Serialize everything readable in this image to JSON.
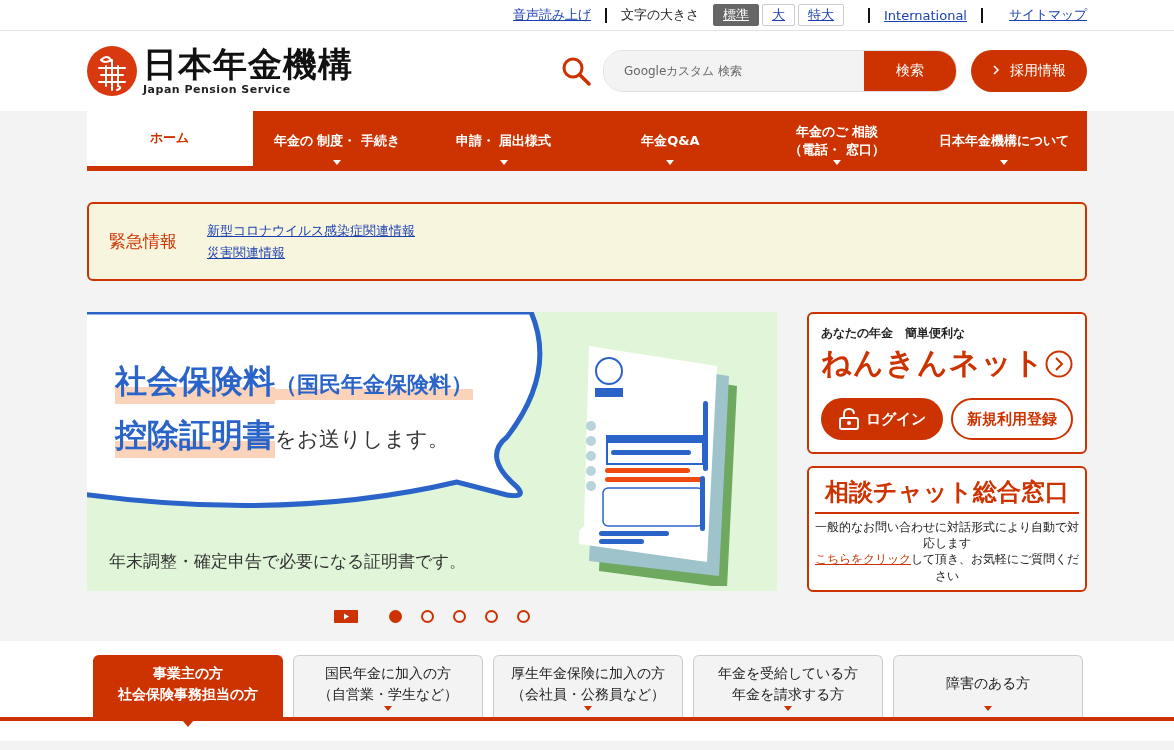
{
  "utility_bar": {
    "read_aloud": "音声読み上げ",
    "font_size_label": "文字の大きさ",
    "font_sizes": [
      {
        "label": "標準",
        "selected": true
      },
      {
        "label": "大",
        "selected": false
      },
      {
        "label": "特大",
        "selected": false
      }
    ],
    "international": "International",
    "sitemap": "サイトマップ"
  },
  "header": {
    "logo_title": "日本年金機構",
    "logo_subtitle": "Japan Pension Service",
    "search": {
      "placeholder": "Googleカスタム 検索",
      "button": "検索"
    },
    "recruit_button": "採用情報"
  },
  "nav": [
    {
      "lines": [
        "ホーム"
      ],
      "selected": true,
      "has_menu": false
    },
    {
      "lines": [
        "年金の 制度・ 手続き"
      ],
      "selected": false,
      "has_menu": true
    },
    {
      "lines": [
        "申請・ 届出様式"
      ],
      "selected": false,
      "has_menu": true
    },
    {
      "lines": [
        "年金Q&A"
      ],
      "selected": false,
      "has_menu": true
    },
    {
      "lines": [
        "年金のご 相談",
        "（電話・ 窓口）"
      ],
      "selected": false,
      "has_menu": true
    },
    {
      "lines": [
        "日本年金機構について"
      ],
      "selected": false,
      "has_menu": true
    }
  ],
  "emergency": {
    "title": "緊急情報",
    "links": [
      "新型コロナウイルス感染症関連情報",
      "災害関連情報"
    ]
  },
  "banner": {
    "headline_1": "社会保険料",
    "headline_1_paren": "（国民年金保険料）",
    "headline_2": "控除証明書",
    "headline_2_tail": "をお送りします。",
    "caption": "年末調整・確定申告で必要になる証明書です。"
  },
  "carousel": {
    "dots": [
      {
        "selected": true
      },
      {
        "selected": false
      },
      {
        "selected": false
      },
      {
        "selected": false
      },
      {
        "selected": false
      }
    ]
  },
  "nenkin_net": {
    "tagline": "あなたの年金　簡単便利な",
    "title": "ねんきんネット",
    "login_button": "ログイン",
    "register_button": "新規利用登録"
  },
  "chat": {
    "title": "相談チャット総合窓口",
    "line_1": "一般的なお問い合わせに対話形式により自動で対応します",
    "link": "こちらをクリック",
    "line_2_rest": "して頂き、お気軽にご質問ください"
  },
  "audience_tabs": [
    {
      "lines": [
        "事業主の方",
        "社会保険事務担当の方"
      ],
      "selected": true
    },
    {
      "lines": [
        "国民年金に加入の方",
        "（自営業・学生など）"
      ],
      "selected": false
    },
    {
      "lines": [
        "厚生年金保険に加入の方",
        "（会社員・公務員など）"
      ],
      "selected": false
    },
    {
      "lines": [
        "年金を受給している方",
        "年金を請求する方"
      ],
      "selected": false
    },
    {
      "lines": [
        "障害のある方"
      ],
      "selected": false
    }
  ]
}
